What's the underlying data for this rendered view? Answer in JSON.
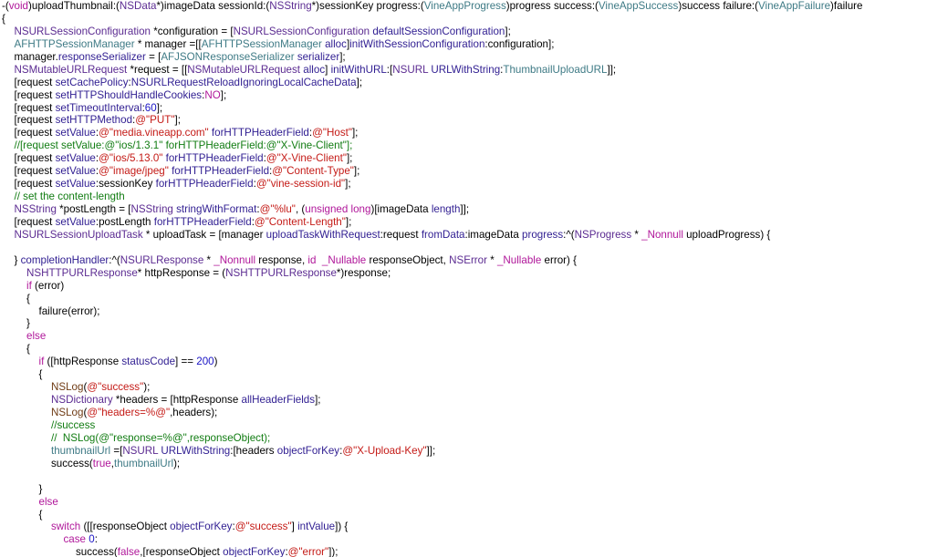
{
  "colors": {
    "background": "#ffffff",
    "plain": "#000000",
    "keyword": "#b0179a",
    "type": "#5b2b91",
    "method": "#2f1d91",
    "class": "#3e7a85",
    "string": "#c41a16",
    "number": "#1b15c5",
    "comment": "#117c12",
    "macro": "#6f3b14"
  },
  "editor": {
    "lines": [
      {
        "indent": 0,
        "tokens": [
          [
            "plain",
            "-("
          ],
          [
            "keyword",
            "void"
          ],
          [
            "plain",
            ")uploadThumbnail:("
          ],
          [
            "type",
            "NSData"
          ],
          [
            "plain",
            "*)imageData sessionId:("
          ],
          [
            "type",
            "NSString"
          ],
          [
            "plain",
            "*)sessionKey progress:("
          ],
          [
            "class",
            "VineAppProgress"
          ],
          [
            "plain",
            ")progress success:("
          ],
          [
            "class",
            "VineAppSuccess"
          ],
          [
            "plain",
            ")success failure:("
          ],
          [
            "class",
            "VineAppFailure"
          ],
          [
            "plain",
            ")failure"
          ]
        ]
      },
      {
        "indent": 0,
        "tokens": [
          [
            "plain",
            "{"
          ]
        ]
      },
      {
        "indent": 1,
        "tokens": [
          [
            "type",
            "NSURLSessionConfiguration"
          ],
          [
            "plain",
            " *configuration = ["
          ],
          [
            "type",
            "NSURLSessionConfiguration"
          ],
          [
            "plain",
            " "
          ],
          [
            "method",
            "defaultSessionConfiguration"
          ],
          [
            "plain",
            "];"
          ]
        ]
      },
      {
        "indent": 1,
        "tokens": [
          [
            "class",
            "AFHTTPSessionManager"
          ],
          [
            "plain",
            " * manager =[["
          ],
          [
            "class",
            "AFHTTPSessionManager"
          ],
          [
            "plain",
            " "
          ],
          [
            "method",
            "alloc"
          ],
          [
            "plain",
            "]"
          ],
          [
            "method",
            "initWithSessionConfiguration"
          ],
          [
            "plain",
            ":configuration];"
          ]
        ]
      },
      {
        "indent": 1,
        "tokens": [
          [
            "plain",
            "manager."
          ],
          [
            "method",
            "responseSerializer"
          ],
          [
            "plain",
            " = ["
          ],
          [
            "class",
            "AFJSONResponseSerializer"
          ],
          [
            "plain",
            " "
          ],
          [
            "method",
            "serializer"
          ],
          [
            "plain",
            "];"
          ]
        ]
      },
      {
        "indent": 1,
        "tokens": [
          [
            "type",
            "NSMutableURLRequest"
          ],
          [
            "plain",
            " *request = [["
          ],
          [
            "type",
            "NSMutableURLRequest"
          ],
          [
            "plain",
            " "
          ],
          [
            "method",
            "alloc"
          ],
          [
            "plain",
            "] "
          ],
          [
            "method",
            "initWithURL"
          ],
          [
            "plain",
            ":["
          ],
          [
            "type",
            "NSURL"
          ],
          [
            "plain",
            " "
          ],
          [
            "method",
            "URLWithString"
          ],
          [
            "plain",
            ":"
          ],
          [
            "class",
            "ThumbnailUploadURL"
          ],
          [
            "plain",
            "]];"
          ]
        ]
      },
      {
        "indent": 1,
        "tokens": [
          [
            "plain",
            "[request "
          ],
          [
            "method",
            "setCachePolicy"
          ],
          [
            "plain",
            ":"
          ],
          [
            "method",
            "NSURLRequestReloadIgnoringLocalCacheData"
          ],
          [
            "plain",
            "];"
          ]
        ]
      },
      {
        "indent": 1,
        "tokens": [
          [
            "plain",
            "[request "
          ],
          [
            "method",
            "setHTTPShouldHandleCookies"
          ],
          [
            "plain",
            ":"
          ],
          [
            "keyword",
            "NO"
          ],
          [
            "plain",
            "];"
          ]
        ]
      },
      {
        "indent": 1,
        "tokens": [
          [
            "plain",
            "[request "
          ],
          [
            "method",
            "setTimeoutInterval"
          ],
          [
            "plain",
            ":"
          ],
          [
            "number",
            "60"
          ],
          [
            "plain",
            "];"
          ]
        ]
      },
      {
        "indent": 1,
        "tokens": [
          [
            "plain",
            "[request "
          ],
          [
            "method",
            "setHTTPMethod"
          ],
          [
            "plain",
            ":"
          ],
          [
            "string",
            "@\"PUT\""
          ],
          [
            "plain",
            "];"
          ]
        ]
      },
      {
        "indent": 1,
        "tokens": [
          [
            "plain",
            "[request "
          ],
          [
            "method",
            "setValue"
          ],
          [
            "plain",
            ":"
          ],
          [
            "string",
            "@\"media.vineapp.com\""
          ],
          [
            "plain",
            " "
          ],
          [
            "method",
            "forHTTPHeaderField"
          ],
          [
            "plain",
            ":"
          ],
          [
            "string",
            "@\"Host\""
          ],
          [
            "plain",
            "];"
          ]
        ]
      },
      {
        "indent": 1,
        "tokens": [
          [
            "comment",
            "//[request setValue:@\"ios/1.3.1\" forHTTPHeaderField:@\"X-Vine-Client\"];"
          ]
        ]
      },
      {
        "indent": 1,
        "tokens": [
          [
            "plain",
            "[request "
          ],
          [
            "method",
            "setValue"
          ],
          [
            "plain",
            ":"
          ],
          [
            "string",
            "@\"ios/5.13.0\""
          ],
          [
            "plain",
            " "
          ],
          [
            "method",
            "forHTTPHeaderField"
          ],
          [
            "plain",
            ":"
          ],
          [
            "string",
            "@\"X-Vine-Client\""
          ],
          [
            "plain",
            "];"
          ]
        ]
      },
      {
        "indent": 1,
        "tokens": [
          [
            "plain",
            "[request "
          ],
          [
            "method",
            "setValue"
          ],
          [
            "plain",
            ":"
          ],
          [
            "string",
            "@\"image/jpeg\""
          ],
          [
            "plain",
            " "
          ],
          [
            "method",
            "forHTTPHeaderField"
          ],
          [
            "plain",
            ":"
          ],
          [
            "string",
            "@\"Content-Type\""
          ],
          [
            "plain",
            "];"
          ]
        ]
      },
      {
        "indent": 1,
        "tokens": [
          [
            "plain",
            "[request "
          ],
          [
            "method",
            "setValue"
          ],
          [
            "plain",
            ":sessionKey "
          ],
          [
            "method",
            "forHTTPHeaderField"
          ],
          [
            "plain",
            ":"
          ],
          [
            "string",
            "@\"vine-session-id\""
          ],
          [
            "plain",
            "];"
          ]
        ]
      },
      {
        "indent": 1,
        "tokens": [
          [
            "comment",
            "// set the content-length"
          ]
        ]
      },
      {
        "indent": 1,
        "tokens": [
          [
            "type",
            "NSString"
          ],
          [
            "plain",
            " *postLength = ["
          ],
          [
            "type",
            "NSString"
          ],
          [
            "plain",
            " "
          ],
          [
            "method",
            "stringWithFormat"
          ],
          [
            "plain",
            ":"
          ],
          [
            "string",
            "@\"%lu\""
          ],
          [
            "plain",
            ", ("
          ],
          [
            "keyword",
            "unsigned long"
          ],
          [
            "plain",
            ")[imageData "
          ],
          [
            "method",
            "length"
          ],
          [
            "plain",
            "]];"
          ]
        ]
      },
      {
        "indent": 1,
        "tokens": [
          [
            "plain",
            "[request "
          ],
          [
            "method",
            "setValue"
          ],
          [
            "plain",
            ":postLength "
          ],
          [
            "method",
            "forHTTPHeaderField"
          ],
          [
            "plain",
            ":"
          ],
          [
            "string",
            "@\"Content-Length\""
          ],
          [
            "plain",
            "];"
          ]
        ]
      },
      {
        "indent": 1,
        "tokens": [
          [
            "type",
            "NSURLSessionUploadTask"
          ],
          [
            "plain",
            " * uploadTask = [manager "
          ],
          [
            "method",
            "uploadTaskWithRequest"
          ],
          [
            "plain",
            ":request "
          ],
          [
            "method",
            "fromData"
          ],
          [
            "plain",
            ":imageData "
          ],
          [
            "method",
            "progress"
          ],
          [
            "plain",
            ":^("
          ],
          [
            "type",
            "NSProgress"
          ],
          [
            "plain",
            " * "
          ],
          [
            "keyword",
            "_Nonnull"
          ],
          [
            "plain",
            " uploadProgress) {"
          ]
        ]
      },
      {
        "indent": 0,
        "tokens": []
      },
      {
        "indent": 1,
        "tokens": [
          [
            "plain",
            "} "
          ],
          [
            "method",
            "completionHandler"
          ],
          [
            "plain",
            ":^("
          ],
          [
            "type",
            "NSURLResponse"
          ],
          [
            "plain",
            " * "
          ],
          [
            "keyword",
            "_Nonnull"
          ],
          [
            "plain",
            " response, "
          ],
          [
            "keyword",
            "id"
          ],
          [
            "plain",
            "  "
          ],
          [
            "keyword",
            "_Nullable"
          ],
          [
            "plain",
            " responseObject, "
          ],
          [
            "type",
            "NSError"
          ],
          [
            "plain",
            " * "
          ],
          [
            "keyword",
            "_Nullable"
          ],
          [
            "plain",
            " error) {"
          ]
        ]
      },
      {
        "indent": 2,
        "tokens": [
          [
            "type",
            "NSHTTPURLResponse"
          ],
          [
            "plain",
            "* httpResponse = ("
          ],
          [
            "type",
            "NSHTTPURLResponse"
          ],
          [
            "plain",
            "*)response;"
          ]
        ]
      },
      {
        "indent": 2,
        "tokens": [
          [
            "keyword",
            "if"
          ],
          [
            "plain",
            " (error)"
          ]
        ]
      },
      {
        "indent": 2,
        "tokens": [
          [
            "plain",
            "{"
          ]
        ]
      },
      {
        "indent": 3,
        "tokens": [
          [
            "plain",
            "failure(error);"
          ]
        ]
      },
      {
        "indent": 2,
        "tokens": [
          [
            "plain",
            "}"
          ]
        ]
      },
      {
        "indent": 2,
        "tokens": [
          [
            "keyword",
            "else"
          ]
        ]
      },
      {
        "indent": 2,
        "tokens": [
          [
            "plain",
            "{"
          ]
        ]
      },
      {
        "indent": 3,
        "tokens": [
          [
            "keyword",
            "if"
          ],
          [
            "plain",
            " ([httpResponse "
          ],
          [
            "method",
            "statusCode"
          ],
          [
            "plain",
            "] == "
          ],
          [
            "number",
            "200"
          ],
          [
            "plain",
            ")"
          ]
        ]
      },
      {
        "indent": 3,
        "tokens": [
          [
            "plain",
            "{"
          ]
        ]
      },
      {
        "indent": 4,
        "tokens": [
          [
            "macro",
            "NSLog"
          ],
          [
            "plain",
            "("
          ],
          [
            "string",
            "@\"success\""
          ],
          [
            "plain",
            ");"
          ]
        ]
      },
      {
        "indent": 4,
        "tokens": [
          [
            "type",
            "NSDictionary"
          ],
          [
            "plain",
            " *headers = [httpResponse "
          ],
          [
            "method",
            "allHeaderFields"
          ],
          [
            "plain",
            "];"
          ]
        ]
      },
      {
        "indent": 4,
        "tokens": [
          [
            "macro",
            "NSLog"
          ],
          [
            "plain",
            "("
          ],
          [
            "string",
            "@\"headers=%@\""
          ],
          [
            "plain",
            ",headers);"
          ]
        ]
      },
      {
        "indent": 4,
        "tokens": [
          [
            "comment",
            "//success"
          ]
        ]
      },
      {
        "indent": 4,
        "tokens": [
          [
            "comment",
            "//  NSLog(@\"response=%@\",responseObject);"
          ]
        ]
      },
      {
        "indent": 4,
        "tokens": [
          [
            "class",
            "thumbnailUrl"
          ],
          [
            "plain",
            " =["
          ],
          [
            "type",
            "NSURL"
          ],
          [
            "plain",
            " "
          ],
          [
            "method",
            "URLWithString"
          ],
          [
            "plain",
            ":[headers "
          ],
          [
            "method",
            "objectForKey"
          ],
          [
            "plain",
            ":"
          ],
          [
            "string",
            "@\"X-Upload-Key\""
          ],
          [
            "plain",
            "]];"
          ]
        ]
      },
      {
        "indent": 4,
        "tokens": [
          [
            "plain",
            "success("
          ],
          [
            "keyword",
            "true"
          ],
          [
            "plain",
            ","
          ],
          [
            "class",
            "thumbnailUrl"
          ],
          [
            "plain",
            ");"
          ]
        ]
      },
      {
        "indent": 0,
        "tokens": []
      },
      {
        "indent": 3,
        "tokens": [
          [
            "plain",
            "}"
          ]
        ]
      },
      {
        "indent": 3,
        "tokens": [
          [
            "keyword",
            "else"
          ]
        ]
      },
      {
        "indent": 3,
        "tokens": [
          [
            "plain",
            "{"
          ]
        ]
      },
      {
        "indent": 4,
        "tokens": [
          [
            "keyword",
            "switch"
          ],
          [
            "plain",
            " ([[responseObject "
          ],
          [
            "method",
            "objectForKey"
          ],
          [
            "plain",
            ":"
          ],
          [
            "string",
            "@\"success\""
          ],
          [
            "plain",
            "] "
          ],
          [
            "method",
            "intValue"
          ],
          [
            "plain",
            "]) {"
          ]
        ]
      },
      {
        "indent": 5,
        "tokens": [
          [
            "keyword",
            "case"
          ],
          [
            "plain",
            " "
          ],
          [
            "number",
            "0"
          ],
          [
            "plain",
            ":"
          ]
        ]
      },
      {
        "indent": 6,
        "tokens": [
          [
            "plain",
            "success("
          ],
          [
            "keyword",
            "false"
          ],
          [
            "plain",
            ",[responseObject "
          ],
          [
            "method",
            "objectForKey"
          ],
          [
            "plain",
            ":"
          ],
          [
            "string",
            "@\"error\""
          ],
          [
            "plain",
            "]);"
          ]
        ]
      }
    ]
  }
}
